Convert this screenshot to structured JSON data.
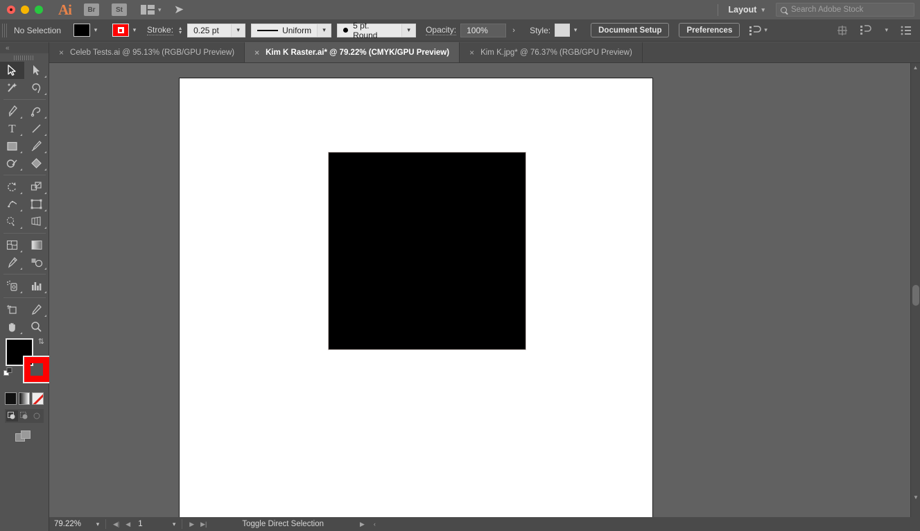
{
  "titlebar": {
    "app_name": "Ai",
    "bridge_label": "Br",
    "stock_label": "St",
    "arrange_icon": "arrange-documents-icon",
    "rocket_icon": "rocket-icon",
    "layout_label": "Layout",
    "search_placeholder": "Search Adobe Stock",
    "window_controls": [
      "close",
      "minimize",
      "maximize"
    ]
  },
  "controlbar": {
    "selection_status": "No Selection",
    "fill_color": "#000000",
    "stroke_color": "#FF0000",
    "stroke_label": "Stroke:",
    "stroke_weight": "0.25 pt",
    "stroke_profile": "Uniform",
    "brush_definition": "5 pt. Round",
    "opacity_label": "Opacity:",
    "opacity_value": "100%",
    "style_label": "Style:",
    "document_setup_label": "Document Setup",
    "preferences_label": "Preferences",
    "align_icon": "align-objects-icon",
    "right_icons": [
      "transform-grid-icon",
      "arrange-icon",
      "list-view-icon"
    ]
  },
  "tabs": [
    {
      "label": "Celeb Tests.ai @ 95.13% (RGB/GPU Preview)",
      "active": false
    },
    {
      "label": "Kim K Raster.ai* @ 79.22% (CMYK/GPU Preview)",
      "active": true
    },
    {
      "label": "Kim K.jpg* @ 76.37% (RGB/GPU Preview)",
      "active": false
    }
  ],
  "toolbar": {
    "collapse_label": "«",
    "tools": [
      {
        "name": "selection-tool",
        "selected": true
      },
      {
        "name": "direct-selection-tool",
        "selected": false
      },
      {
        "name": "magic-wand-tool",
        "selected": false
      },
      {
        "name": "lasso-tool",
        "selected": false
      },
      {
        "name": "pen-tool",
        "selected": false
      },
      {
        "name": "curvature-tool",
        "selected": false
      },
      {
        "name": "type-tool",
        "selected": false
      },
      {
        "name": "line-segment-tool",
        "selected": false
      },
      {
        "name": "rectangle-tool",
        "selected": false
      },
      {
        "name": "paintbrush-tool",
        "selected": false
      },
      {
        "name": "shaper-tool",
        "selected": false
      },
      {
        "name": "eraser-tool",
        "selected": false
      },
      {
        "name": "rotate-tool",
        "selected": false
      },
      {
        "name": "scale-tool",
        "selected": false
      },
      {
        "name": "width-tool",
        "selected": false
      },
      {
        "name": "free-transform-tool",
        "selected": false
      },
      {
        "name": "shape-builder-tool",
        "selected": false
      },
      {
        "name": "perspective-grid-tool",
        "selected": false
      },
      {
        "name": "mesh-tool",
        "selected": false
      },
      {
        "name": "gradient-tool",
        "selected": false
      },
      {
        "name": "eyedropper-tool",
        "selected": false
      },
      {
        "name": "blend-tool",
        "selected": false
      },
      {
        "name": "symbol-sprayer-tool",
        "selected": false
      },
      {
        "name": "column-graph-tool",
        "selected": false
      },
      {
        "name": "artboard-tool",
        "selected": false
      },
      {
        "name": "slice-tool",
        "selected": false
      },
      {
        "name": "hand-tool",
        "selected": false
      },
      {
        "name": "zoom-tool",
        "selected": false
      }
    ],
    "fill_color": "#000000",
    "stroke_color": "#FF0000",
    "color_modes": [
      "solid-color",
      "gradient",
      "none"
    ],
    "draw_modes": [
      "draw-normal",
      "draw-behind",
      "draw-inside"
    ],
    "screen_mode": "change-screen-mode"
  },
  "canvas": {
    "artboard_background": "#FFFFFF",
    "canvas_background": "#616161",
    "shape": {
      "name": "black-square",
      "fill": "#000000"
    }
  },
  "statusbar": {
    "zoom_level": "79.22%",
    "page_number": "1",
    "message": "Toggle Direct Selection"
  }
}
